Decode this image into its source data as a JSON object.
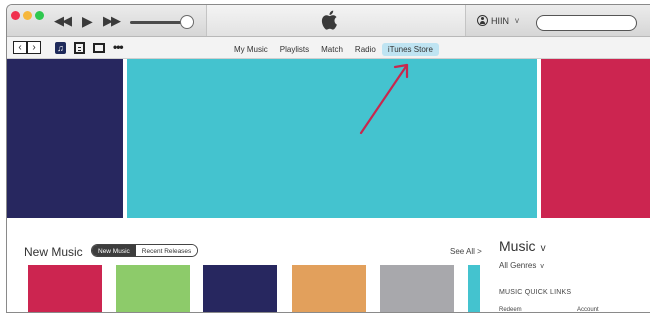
{
  "titlebar": {
    "account_name": "HIIN",
    "account_caret": "v",
    "search_placeholder": "",
    "controls": {
      "prev": "◀◀",
      "play": "▶",
      "next": "▶▶"
    }
  },
  "navbar": {
    "back": "‹",
    "forward": "›",
    "music_glyph": "♫",
    "more": "•••",
    "tabs": [
      {
        "label": "My Music",
        "active": false
      },
      {
        "label": "Playlists",
        "active": false
      },
      {
        "label": "Match",
        "active": false
      },
      {
        "label": "Radio",
        "active": false
      },
      {
        "label": "iTunes Store",
        "active": true
      }
    ]
  },
  "hero": {
    "colors": [
      "#27275f",
      "#44c3cf",
      "#cc2550"
    ],
    "annotation_arrow_color": "#c8274e"
  },
  "new_music": {
    "title": "New Music",
    "segments": [
      {
        "label": "New Music",
        "active": true
      },
      {
        "label": "Recent Releases",
        "active": false
      }
    ],
    "see_all": "See All  >",
    "tile_colors": [
      "#cc2550",
      "#8dcb6a",
      "#27275f",
      "#e2a05c",
      "#a8a8ac",
      "#44c3cf"
    ]
  },
  "sidebar": {
    "title": "Music",
    "title_caret": "v",
    "genres": "All Genres",
    "genres_caret": "v",
    "quick_links_title": "MUSIC QUICK LINKS",
    "links": [
      "Redeem",
      "Account"
    ]
  },
  "icons": [
    "apple-icon",
    "user-icon",
    "music-icon",
    "film-icon",
    "tv-icon",
    "more-icon",
    "search-icon"
  ]
}
